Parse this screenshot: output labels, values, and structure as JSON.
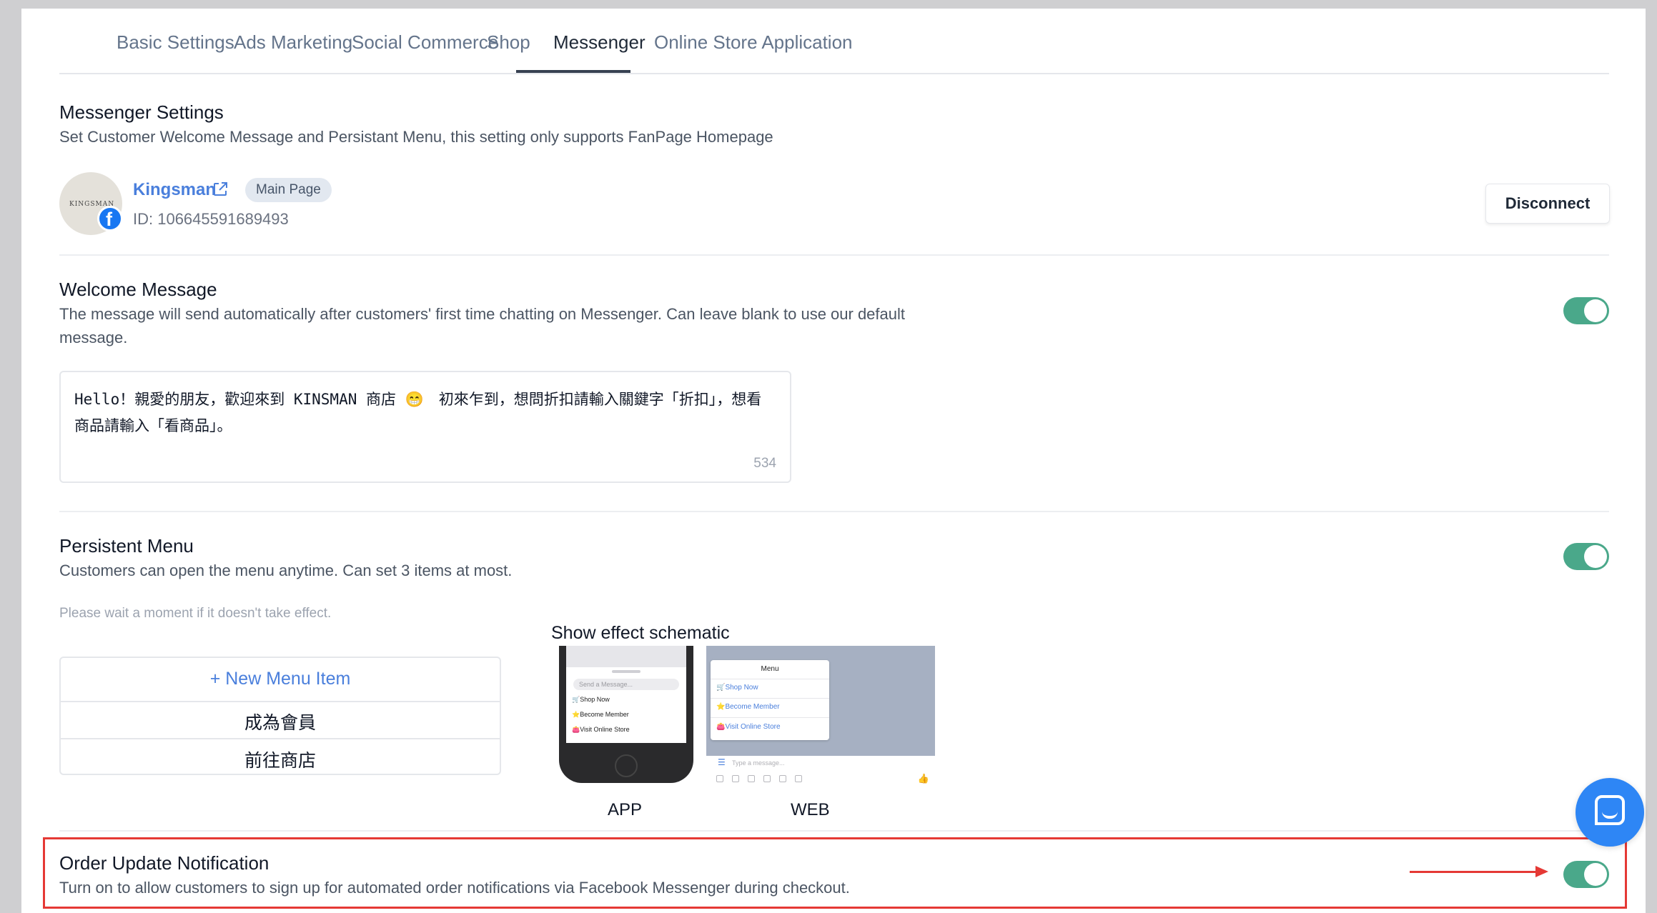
{
  "tabs": [
    {
      "label": "Basic Settings"
    },
    {
      "label": "Ads Marketing"
    },
    {
      "label": "Social Commerce"
    },
    {
      "label": "Shop"
    },
    {
      "label": "Messenger"
    },
    {
      "label": "Online Store Application"
    }
  ],
  "active_tab": "Messenger",
  "messenger": {
    "title": "Messenger Settings",
    "desc": "Set Customer Welcome Message and Persistant Menu, this setting only supports FanPage Homepage"
  },
  "account": {
    "avatar_text": "KINGSMAN",
    "name": "Kingsman",
    "badge": "Main Page",
    "id": "ID: 106645591689493",
    "disconnect": "Disconnect"
  },
  "welcome": {
    "title": "Welcome Message",
    "desc": "The message will send automatically after customers' first time chatting on Messenger. Can leave blank to use our default message.",
    "enabled": true,
    "message": "Hello！親愛的朋友，歡迎來到 KINSMAN 商店 😁　初來乍到，想問折扣請輸入關鍵字「折扣」，想看商品請輸入「看商品」。",
    "count": "534"
  },
  "persistent": {
    "title": "Persistent Menu",
    "desc": "Customers can open the menu anytime. Can set 3 items at most.",
    "enabled": true,
    "note": "Please wait a moment if it doesn't take effect.",
    "add_label": "+ New Menu Item",
    "items": [
      "成為會員",
      "前往商店"
    ]
  },
  "schematic": {
    "title": "Show effect schematic",
    "app_caption": "APP",
    "web_caption": "WEB",
    "input_placeholder": "Send a Message...",
    "web_placeholder": "Type a message...",
    "menu_title": "Menu",
    "items": [
      "Shop Now",
      "Become Member",
      "Visit Online Store"
    ],
    "item_icons": [
      "🛒",
      "⭐",
      "👛"
    ]
  },
  "order": {
    "title": "Order Update Notification",
    "desc": "Turn on to allow customers to sign up for automated order notifications via Facebook Messenger during checkout.",
    "enabled": true
  },
  "colors": {
    "accent": "#4a7fdc",
    "toggle_on": "#4aa88a",
    "highlight": "#e53935",
    "chat": "#2e86f5"
  }
}
